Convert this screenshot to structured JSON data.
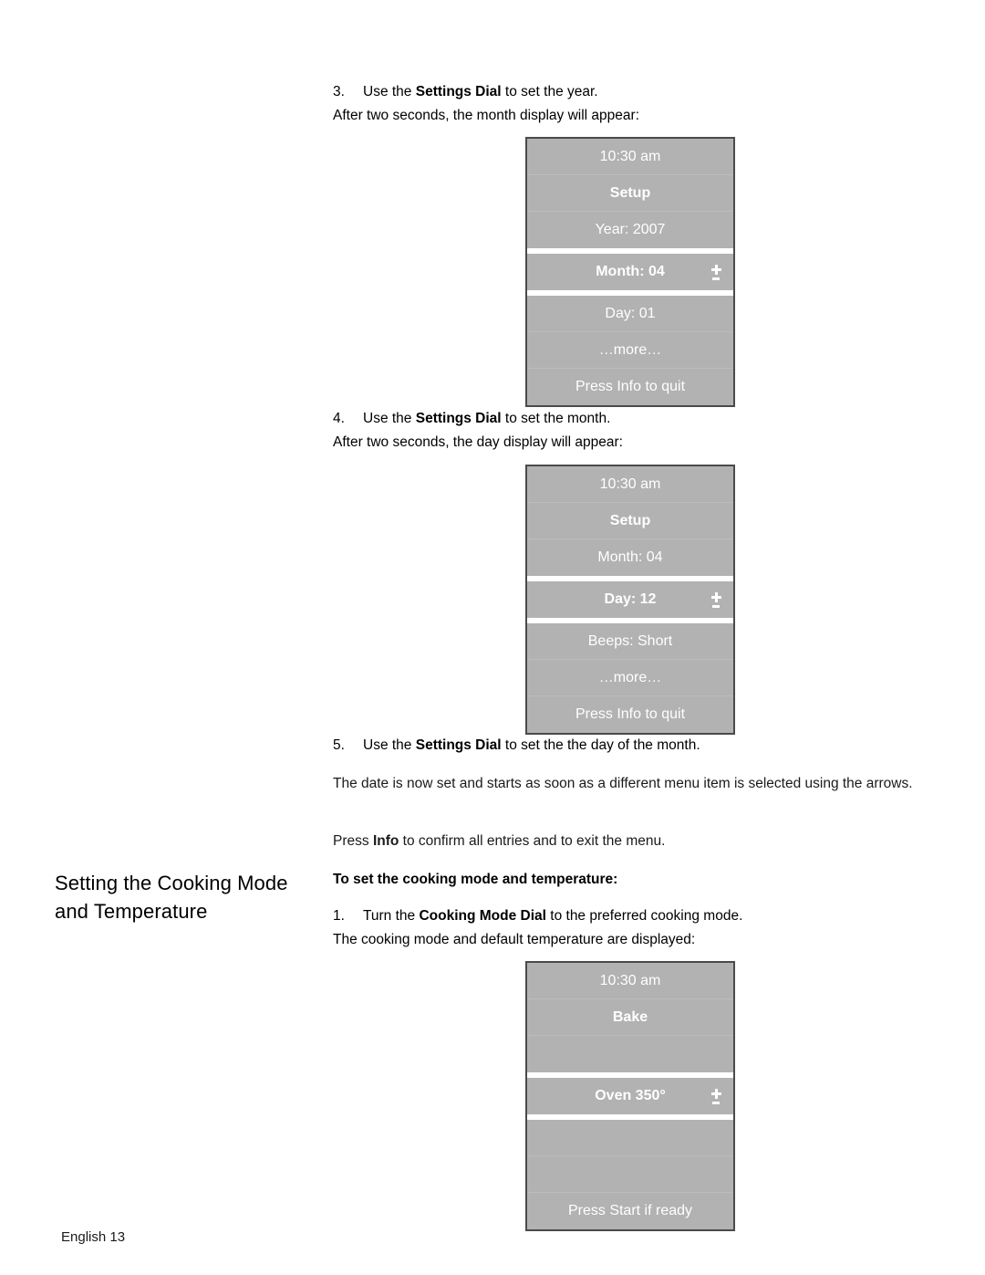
{
  "page": {
    "footer": "English 13"
  },
  "steps": {
    "step3": {
      "num": "3.",
      "pre": "Use the ",
      "bold": "Settings Dial",
      "post": " to set the year.",
      "sub": "After two seconds, the month display will appear:"
    },
    "step4": {
      "num": "4.",
      "pre": "Use the ",
      "bold": "Settings Dial",
      "post": " to set the month.",
      "sub": "After two seconds, the day display will appear:"
    },
    "step5": {
      "num": "5.",
      "pre": "Use the ",
      "bold": "Settings Dial",
      "post": " to set the the day of the month."
    },
    "step1_cooking": {
      "num": "1.",
      "pre": "Turn the ",
      "bold": "Cooking Mode Dial",
      "post": " to the preferred cooking mode.",
      "sub": "The cooking mode and default temperature are displayed:"
    }
  },
  "paragraphs": {
    "date_set": "The date is now set and starts as soon as a different menu item is selected using the arrows.",
    "press_info_pre": "Press ",
    "press_info_bold": "Info",
    "press_info_post": " to confirm all entries and to exit the menu."
  },
  "section": {
    "heading": "Setting the Cooking Mode and Temperature",
    "subhead": "To set the cooking mode and temperature:"
  },
  "displays": [
    {
      "name": "month-setup-display",
      "top_rows": [
        {
          "text": "10:30 am",
          "bold": false
        },
        {
          "text": "Setup",
          "bold": true
        },
        {
          "text": "Year: 2007",
          "bold": false
        }
      ],
      "selected_row": {
        "text": "Month: 04",
        "adjust_icon": "plus-minus-icon"
      },
      "bottom_rows": [
        {
          "text": "Day: 01",
          "bold": false
        },
        {
          "text": "…more…",
          "bold": false
        },
        {
          "text": "Press Info to quit",
          "bold": false
        }
      ]
    },
    {
      "name": "day-setup-display",
      "top_rows": [
        {
          "text": "10:30 am",
          "bold": false
        },
        {
          "text": "Setup",
          "bold": true
        },
        {
          "text": "Month: 04",
          "bold": false
        }
      ],
      "selected_row": {
        "text": "Day: 12",
        "adjust_icon": "plus-minus-icon"
      },
      "bottom_rows": [
        {
          "text": "Beeps: Short",
          "bold": false
        },
        {
          "text": "…more…",
          "bold": false
        },
        {
          "text": "Press Info to quit",
          "bold": false
        }
      ]
    },
    {
      "name": "bake-temperature-display",
      "top_rows": [
        {
          "text": "10:30 am",
          "bold": false
        },
        {
          "text": "Bake",
          "bold": true
        },
        {
          "text": "",
          "bold": false
        }
      ],
      "selected_row": {
        "text": "Oven 350°",
        "adjust_icon": "plus-minus-icon"
      },
      "bottom_rows": [
        {
          "text": "",
          "bold": false
        },
        {
          "text": "",
          "bold": false
        },
        {
          "text": "Press Start if ready",
          "bold": false
        }
      ]
    }
  ],
  "colors": {
    "lcd_background": "#b2b2b2",
    "lcd_text": "#ffffff",
    "lcd_border": "#4a4a4a",
    "page_background": "#ffffff"
  }
}
